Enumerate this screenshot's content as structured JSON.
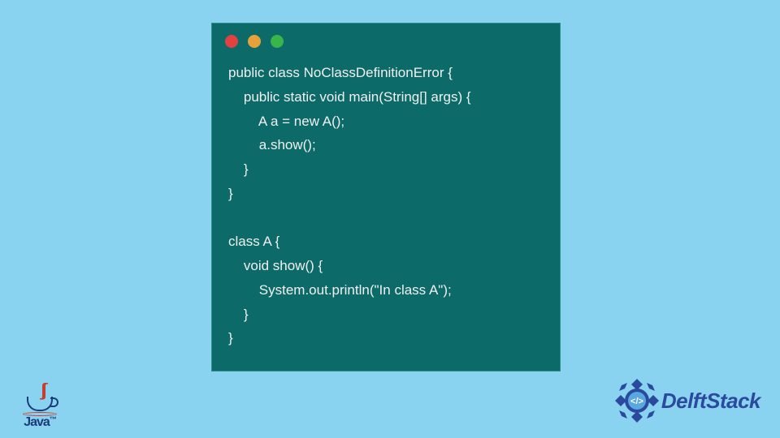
{
  "code": {
    "lines": [
      "public class NoClassDefinitionError {",
      "    public static void main(String[] args) {",
      "        A a = new A();",
      "        a.show();",
      "    }",
      "}",
      "",
      "class A {",
      "    void show() {",
      "        System.out.println(\"In class A\");",
      "    }",
      "}"
    ]
  },
  "window": {
    "dots": {
      "red": "#e24141",
      "yellow": "#e8a13a",
      "green": "#3ab54a"
    },
    "bg": "#0c6a68"
  },
  "javaLogo": {
    "label": "Java",
    "trademark": "™"
  },
  "delftStack": {
    "label": "DelftStack",
    "badge_symbol": "</>"
  },
  "page": {
    "bg": "#8ad3f0"
  }
}
